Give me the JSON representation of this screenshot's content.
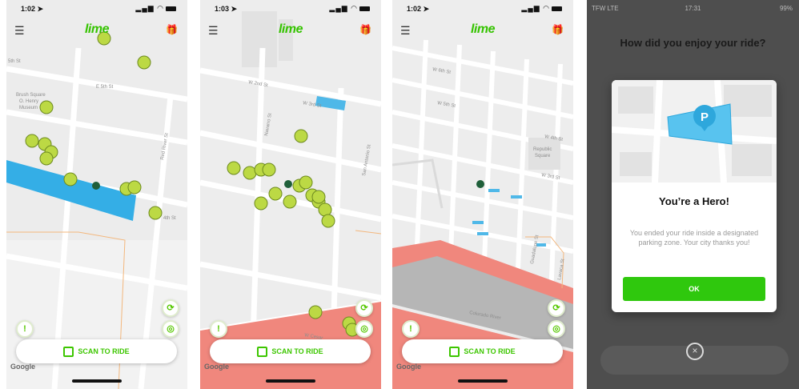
{
  "screens": [
    {
      "time": "1:02 ➤",
      "brand": "lime",
      "scan_label": "SCAN TO RIDE",
      "google_label": "Google",
      "map_labels": [
        "5th St",
        "E 5th St",
        "Brush Square",
        "O. Henry",
        "Museum",
        "4th St",
        "Red River St"
      ],
      "icons": {
        "menu": "☰",
        "gift": "🎁",
        "report": "!",
        "refresh": "⟳",
        "locate": "◎"
      }
    },
    {
      "time": "1:03 ➤",
      "brand": "lime",
      "scan_label": "SCAN TO RIDE",
      "google_label": "Google",
      "map_labels": [
        "W 3rd St",
        "W 2nd St",
        "Navarro St",
        "San Antonio St",
        "W Cesar"
      ],
      "icons": {
        "menu": "☰",
        "gift": "🎁",
        "report": "!",
        "refresh": "⟳",
        "locate": "◎"
      }
    },
    {
      "time": "1:02 ➤",
      "brand": "lime",
      "scan_label": "SCAN TO RIDE",
      "google_label": "Google",
      "map_labels": [
        "W 6th St",
        "W 5th St",
        "W 4th St",
        "W 3rd St",
        "Republic",
        "Square",
        "Colorado River",
        "Lavaca St",
        "Guadalupe St"
      ],
      "icons": {
        "menu": "☰",
        "gift": "🎁",
        "report": "!",
        "refresh": "⟳",
        "locate": "◎"
      }
    }
  ],
  "feedback": {
    "carrier": "TFW  LTE",
    "time": "17:31",
    "battery": "99%",
    "question": "How did you enjoy your ride?",
    "modal_title": "You’re a Hero!",
    "modal_body": "You ended your ride inside a designated parking zone. Your city thanks you!",
    "ok_label": "OK",
    "parking_letter": "P",
    "close_icon": "×"
  },
  "colors": {
    "brand_green": "#35c300",
    "parking_blue": "#4fb8e8",
    "river_red": "#f08a80",
    "map_bg": "#ededed"
  }
}
